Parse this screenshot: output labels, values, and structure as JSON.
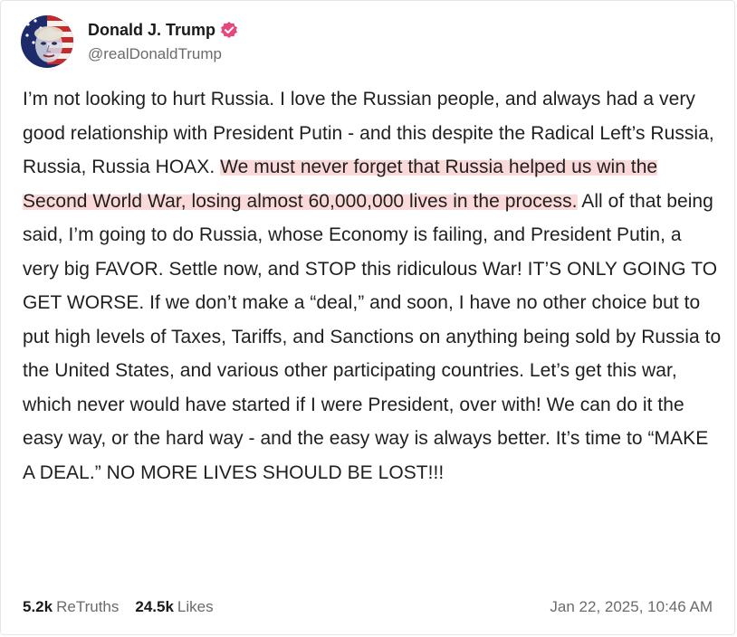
{
  "post": {
    "display_name": "Donald J. Trump",
    "handle": "@realDonaldTrump",
    "verified_icon": "verified-badge-icon",
    "accent_color": "#e5487a",
    "highlight_color": "#f8baba",
    "text_before": "I’m not looking to hurt Russia. I love the Russian people, and always had a very good relationship with President Putin - and this despite the Radical Left’s Russia, Russia, Russia HOAX. ",
    "text_highlighted": "We must never forget that Russia helped us win the Second World War, losing almost 60,000,000 lives in the process.",
    "text_after": " All of that being said, I’m going to do Russia, whose Economy is failing, and President Putin, a very big FAVOR. Settle now, and STOP this ridiculous War! IT’S ONLY GOING TO GET WORSE. If we don’t make a “deal,” and soon, I have no other choice but to put high levels of Taxes, Tariffs, and Sanctions on anything being sold by Russia to the United States, and various other participating countries. Let’s get this war, which never would have started if I were President, over with! We can do it the easy way, or the hard way - and the easy way is always better. It’s time to “MAKE A DEAL.” NO MORE LIVES SHOULD BE LOST!!!"
  },
  "stats": {
    "retruths_count": "5.2k",
    "retruths_label": "ReTruths",
    "likes_count": "24.5k",
    "likes_label": "Likes"
  },
  "timestamp": "Jan 22, 2025, 10:46 AM"
}
